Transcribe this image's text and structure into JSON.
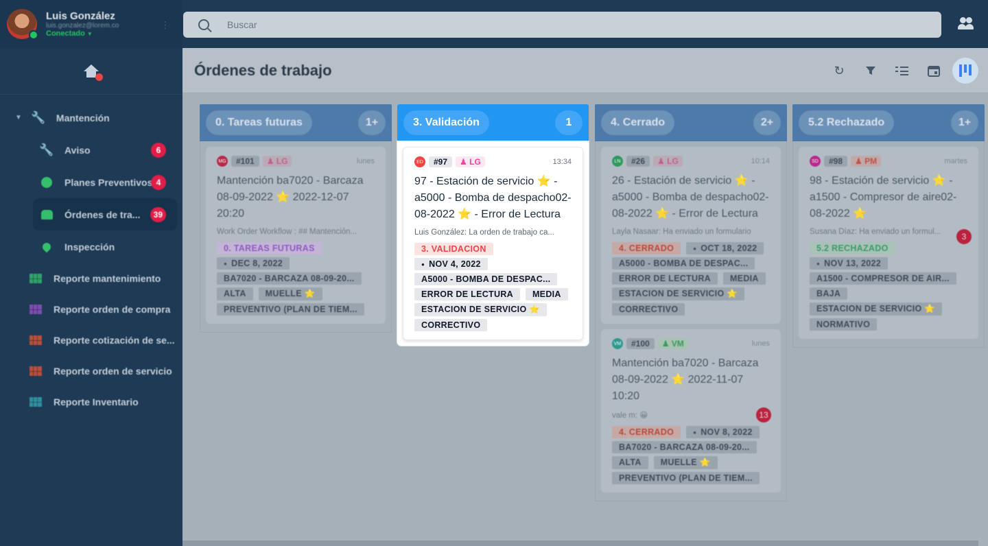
{
  "user": {
    "name": "Luis González",
    "email": "luis.gonzalez@lorem.co",
    "status": "Conectado"
  },
  "sidebar": {
    "group": "Mantención",
    "items": [
      {
        "label": "Aviso",
        "count": "6"
      },
      {
        "label": "Planes Preventivos",
        "count": "4"
      },
      {
        "label": "Órdenes de tra...",
        "count": "39"
      },
      {
        "label": "Inspección"
      }
    ],
    "reports": [
      {
        "label": "Reporte mantenimiento",
        "color": "#2fa36b"
      },
      {
        "label": "Reporte orden de compra",
        "color": "#7b4fb0"
      },
      {
        "label": "Reporte cotización de se...",
        "color": "#b5503e"
      },
      {
        "label": "Reporte orden de servicio",
        "color": "#b5503e"
      },
      {
        "label": "Reporte Inventario",
        "color": "#2f8fa0"
      }
    ]
  },
  "search": {
    "placeholder": "Buscar"
  },
  "page": {
    "title": "Órdenes de trabajo"
  },
  "columns": [
    {
      "title": "0. Tareas futuras",
      "count": "1+",
      "cards": [
        {
          "initials": "MG",
          "avatar_color": "#b52a4a",
          "id": "#101",
          "user": "LG",
          "user_color": "#c06090",
          "time": "lunes",
          "title": "Mantención ba7020 - Barcaza 08-09-2022 ⭐ 2022-12-07 20:20",
          "note": "Work Order Workflow : ## Mantención...",
          "status": "0. TAREAS FUTURAS",
          "status_color": "#8d5cc0",
          "status_bg": "#c4b4d6",
          "date": "DEC 8, 2022",
          "tags": [
            "BA7020 - BARCAZA 08-09-20...",
            "ALTA",
            "MUELLE ⭐",
            "PREVENTIVO (PLAN DE TIEM..."
          ]
        }
      ]
    },
    {
      "title": "3. Validación",
      "count": "1",
      "cards": [
        {
          "initials": "ED",
          "avatar_color": "#ef4444",
          "id": "#97",
          "user": "LG",
          "user_color": "#ec4899",
          "time": "13:34",
          "title": "97 - Estación de servicio ⭐ - a5000 - Bomba de despacho02-08-2022 ⭐ - Error de Lectura",
          "note": "Luis González: La orden de trabajo ca...",
          "status": "3. VALIDACION",
          "date": "NOV 4, 2022",
          "tags": [
            "A5000 - BOMBA DE DESPAC...",
            "ERROR DE LECTURA",
            "MEDIA",
            "ESTACION DE SERVICIO ⭐",
            "CORRECTIVO"
          ]
        }
      ]
    },
    {
      "title": "4. Cerrado",
      "count": "2+",
      "cards": [
        {
          "initials": "LN",
          "avatar_color": "#2e9a5e",
          "id": "#26",
          "user": "LG",
          "user_color": "#c06090",
          "time": "10:14",
          "title": "26 - Estación de servicio ⭐ - a5000 - Bomba de despacho02-08-2022 ⭐ - Error de Lectura",
          "note": "Layla Nasaar: Ha enviado un formulario",
          "status": "4. CERRADO",
          "status_color": "#b84a3c",
          "status_bg": "#c6a9a5",
          "date": "OCT 18, 2022",
          "tags": [
            "A5000 - BOMBA DE DESPAC...",
            "ERROR DE LECTURA",
            "MEDIA",
            "ESTACION DE SERVICIO ⭐",
            "CORRECTIVO"
          ]
        },
        {
          "initials": "VM",
          "avatar_color": "#2e9a8e",
          "id": "#100",
          "user": "VM",
          "user_color": "#3a9a5e",
          "time": "lunes",
          "title": "Mantención ba7020 - Barcaza 08-09-2022 ⭐ 2022-11-07 10:20",
          "note": "vale m: 😀",
          "bubble": "13",
          "status": "4. CERRADO",
          "status_color": "#b84a3c",
          "status_bg": "#c6a9a5",
          "date": "NOV 8, 2022",
          "tags": [
            "BA7020 - BARCAZA 08-09-20...",
            "ALTA",
            "MUELLE ⭐",
            "PREVENTIVO (PLAN DE TIEM..."
          ]
        }
      ]
    },
    {
      "title": "5.2 Rechazado",
      "count": "1+",
      "cards": [
        {
          "initials": "SD",
          "avatar_color": "#b52a8a",
          "id": "#98",
          "user": "PM",
          "user_color": "#c0504a",
          "time": "martes",
          "title": "98 - Estación de servicio ⭐ - a1500 - Compresor de aire02-08-2022 ⭐",
          "note": "Susana Díaz: Ha enviado un formul...",
          "bubble": "3",
          "status": "5.2 RECHAZADO",
          "status_color": "#3a9a6e",
          "status_bg": "#a9c2b6",
          "date": "NOV 13, 2022",
          "tags": [
            "A1500 - COMPRESOR DE AIR...",
            "BAJA",
            "ESTACION DE SERVICIO ⭐",
            "NORMATIVO"
          ]
        }
      ]
    }
  ],
  "icons": [
    "search-icon",
    "people-icon",
    "home-icon",
    "refresh-icon",
    "filter-icon",
    "list-icon",
    "calendar-icon",
    "kanban-icon"
  ]
}
